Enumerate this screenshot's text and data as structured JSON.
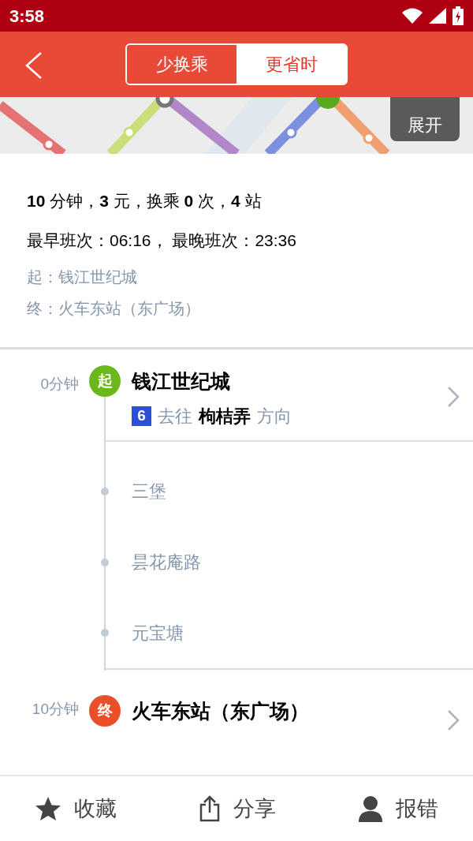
{
  "status_bar": {
    "time": "3:58"
  },
  "header": {
    "tabs": [
      {
        "label": "少换乘",
        "selected": true
      },
      {
        "label": "更省时",
        "selected": false
      }
    ]
  },
  "map": {
    "kind": "picture",
    "expand_button": "展开"
  },
  "summary": {
    "line": "**10** 分钟，**3** 元，换乘 **0** 次，**4** 站",
    "schedule": "最早班次：06:16， 最晚班次：23:36",
    "from": "起：钱江世纪城",
    "to": "终：火车东站（东广场）"
  },
  "route": {
    "start": {
      "time": "0分钟",
      "badge": "起",
      "color": "#6cb81c",
      "name": "钱江世纪城",
      "line_number": "6",
      "toward": "去往",
      "terminus": "枸桔弄",
      "direction": "方向"
    },
    "stops": [
      "三堡",
      "昙花庵路",
      "元宝塘"
    ],
    "end": {
      "time": "10分钟",
      "badge": "终",
      "color": "#ea4f2a",
      "name": "火车东站（东广场）"
    }
  },
  "bottom_bar": [
    {
      "kind": "star",
      "label": "收藏"
    },
    {
      "kind": "share",
      "label": "分享"
    },
    {
      "kind": "person",
      "label": "报错"
    }
  ]
}
